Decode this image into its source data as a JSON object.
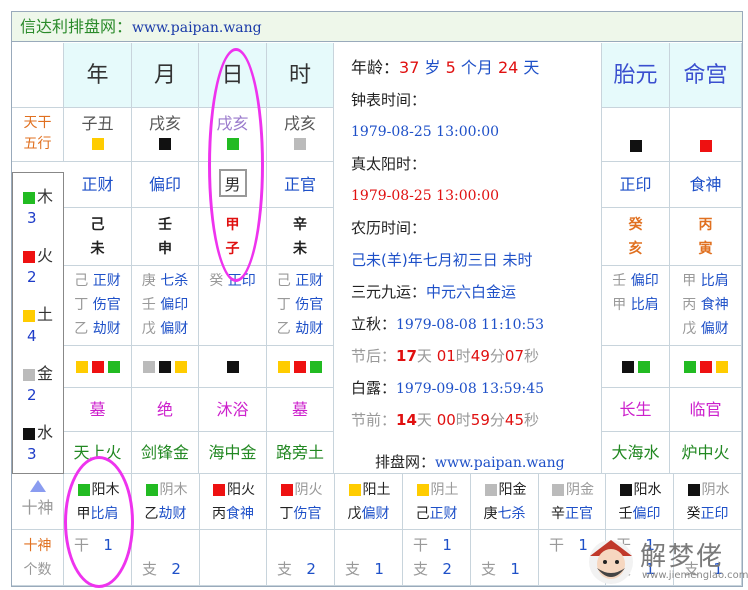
{
  "title": {
    "prefix": "信达利排盘网：",
    "url": "www.paipan.wang"
  },
  "headers": {
    "year": "年",
    "month": "月",
    "day": "日",
    "hour": "时",
    "taiyuan": "胎元",
    "minggong": "命宫"
  },
  "left_labels": {
    "tiangan": "天干",
    "wuxing": "五行",
    "shishen": "十神",
    "geshu": "个数"
  },
  "kongwang": [
    "子丑",
    "戌亥",
    "戌亥",
    "戌亥"
  ],
  "ten_gods_top": [
    "正财",
    "偏印",
    "男",
    "正官"
  ],
  "pillars": [
    {
      "gan": "己",
      "zhi": "未"
    },
    {
      "gan": "壬",
      "zhi": "申"
    },
    {
      "gan": "甲",
      "zhi": "子"
    },
    {
      "gan": "辛",
      "zhi": "未"
    }
  ],
  "hidden": [
    [
      {
        "g": "己",
        "s": "正财"
      },
      {
        "g": "丁",
        "s": "伤官"
      },
      {
        "g": "乙",
        "s": "劫财"
      }
    ],
    [
      {
        "g": "庚",
        "s": "七杀"
      },
      {
        "g": "壬",
        "s": "偏印"
      },
      {
        "g": "戊",
        "s": "偏财"
      }
    ],
    [
      {
        "g": "癸",
        "s": "正印"
      }
    ],
    [
      {
        "g": "己",
        "s": "正财"
      },
      {
        "g": "丁",
        "s": "伤官"
      },
      {
        "g": "乙",
        "s": "劫财"
      }
    ]
  ],
  "stages": [
    "墓",
    "绝",
    "沐浴",
    "墓"
  ],
  "nayin": [
    "天上火",
    "剑锋金",
    "海中金",
    "路旁土"
  ],
  "info": {
    "age_label": "年龄：",
    "age_years": "37",
    "sui": "岁",
    "months": "5",
    "geyue": "个月",
    "days": "24",
    "tian": "天",
    "clock_label": "钟表时间：",
    "clock_value": "1979-08-25 13:00:00",
    "solar_label": "真太阳时：",
    "solar_value": "1979-08-25 13:00:00",
    "lunar_label": "农历时间：",
    "lunar_value": "己未(羊)年七月初三日 未时",
    "sanyuan_label": "三元九运：",
    "sanyuan_value": "中元六白金运",
    "liqiu_label": "立秋：",
    "liqiu_value": "1979-08-08 11:10:53",
    "jiehou_label": "节后：",
    "jiehou_d": "17",
    "jiehou_h": "01",
    "jiehou_m": "49",
    "jiehou_s": "07",
    "bailu_label": "白露：",
    "bailu_value": "1979-09-08 13:59:45",
    "jieqian_label": "节前：",
    "jieqian_d": "14",
    "jieqian_h": "00",
    "jieqian_m": "59",
    "jieqian_s": "45",
    "unit_tian": "天",
    "unit_shi": "时",
    "unit_fen": "分",
    "unit_miao": "秒",
    "paipan_label": "排盘网：",
    "paipan_url": "www.paipan.wang"
  },
  "taiyuan": {
    "shishen": "正印",
    "gan": "癸",
    "zhi": "亥",
    "hidden": [
      {
        "g": "壬",
        "s": "偏印"
      },
      {
        "g": "甲",
        "s": "比肩"
      }
    ],
    "stage": "长生",
    "nayin": "大海水"
  },
  "minggong": {
    "shishen": "食神",
    "gan": "丙",
    "zhi": "寅",
    "hidden": [
      {
        "g": "甲",
        "s": "比肩"
      },
      {
        "g": "丙",
        "s": "食神"
      },
      {
        "g": "戊",
        "s": "偏财"
      }
    ],
    "stage": "临官",
    "nayin": "炉中火"
  },
  "legend": [
    {
      "name": "木",
      "count": "3",
      "color": "#22bb22"
    },
    {
      "name": "火",
      "count": "2",
      "color": "#ee1111"
    },
    {
      "name": "土",
      "count": "4",
      "color": "#ffcc00"
    },
    {
      "name": "金",
      "count": "2",
      "color": "#bbbbbb"
    },
    {
      "name": "水",
      "count": "3",
      "color": "#111111"
    }
  ],
  "gods_table": [
    {
      "yinyang": "阳木",
      "gan": "甲",
      "god": "比肩",
      "gan_count": "1",
      "zhi_count": ""
    },
    {
      "yinyang": "阴木",
      "gan": "乙",
      "god": "劫财",
      "gan_count": "",
      "zhi_count": "2"
    },
    {
      "yinyang": "阳火",
      "gan": "丙",
      "god": "食神",
      "gan_count": "",
      "zhi_count": ""
    },
    {
      "yinyang": "阴火",
      "gan": "丁",
      "god": "伤官",
      "gan_count": "",
      "zhi_count": "2"
    },
    {
      "yinyang": "阳土",
      "gan": "戊",
      "god": "偏财",
      "gan_count": "",
      "zhi_count": "1"
    },
    {
      "yinyang": "阴土",
      "gan": "己",
      "god": "正财",
      "gan_count": "1",
      "zhi_count": "2"
    },
    {
      "yinyang": "阳金",
      "gan": "庚",
      "god": "七杀",
      "gan_count": "",
      "zhi_count": "1"
    },
    {
      "yinyang": "阴金",
      "gan": "辛",
      "god": "正官",
      "gan_count": "1",
      "zhi_count": ""
    },
    {
      "yinyang": "阳水",
      "gan": "壬",
      "god": "偏印",
      "gan_count": "1",
      "zhi_count": "1"
    },
    {
      "yinyang": "阴水",
      "gan": "癸",
      "god": "正印",
      "gan_count": "",
      "zhi_count": "1"
    }
  ],
  "count_labels": {
    "gan": "干",
    "zhi": "支"
  },
  "watermark": {
    "name": "解梦佬",
    "site": "www.jiemenglao.com"
  }
}
